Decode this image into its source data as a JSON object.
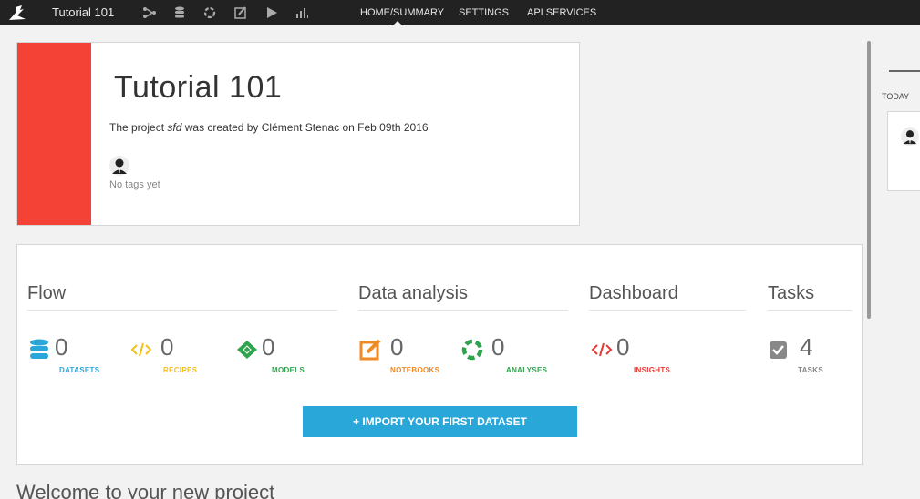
{
  "topbar": {
    "project_title": "Tutorial 101",
    "icons": [
      "bird-logo-icon",
      "flow-icon",
      "datasets-icon",
      "analyses-icon",
      "notebooks-icon",
      "jobs-play-icon",
      "dashboard-icon"
    ],
    "nav": [
      {
        "label": "HOME/SUMMARY",
        "active": true
      },
      {
        "label": "SETTINGS",
        "active": false
      },
      {
        "label": "API SERVICES",
        "active": false
      }
    ]
  },
  "project": {
    "title": "Tutorial 101",
    "desc_prefix": "The project ",
    "desc_key": "sfd",
    "desc_suffix": " was created by Clément Stenac on Feb 09th 2016",
    "tags": "No tags yet",
    "accent_color": "#f44336"
  },
  "sections": {
    "flow": "Flow",
    "analysis": "Data analysis",
    "dashboard": "Dashboard",
    "tasks": "Tasks"
  },
  "stats": {
    "datasets": {
      "count": "0",
      "label": "DATASETS",
      "color": "#29a7d8"
    },
    "recipes": {
      "count": "0",
      "label": "RECIPES",
      "color": "#f5c018"
    },
    "models": {
      "count": "0",
      "label": "MODELS",
      "color": "#2ea44f"
    },
    "notebooks": {
      "count": "0",
      "label": "NOTEBOOKS",
      "color": "#f08a24"
    },
    "analyses": {
      "count": "0",
      "label": "ANALYSES",
      "color": "#2ea44f"
    },
    "insights": {
      "count": "0",
      "label": "INSIGHTS",
      "color": "#e53935"
    },
    "tasks": {
      "count": "4",
      "label": "TASKS",
      "color": "#888888"
    }
  },
  "import_button": "+ IMPORT YOUR FIRST DATASET",
  "welcome": "Welcome to your new project",
  "timeline": {
    "today": "TODAY"
  }
}
